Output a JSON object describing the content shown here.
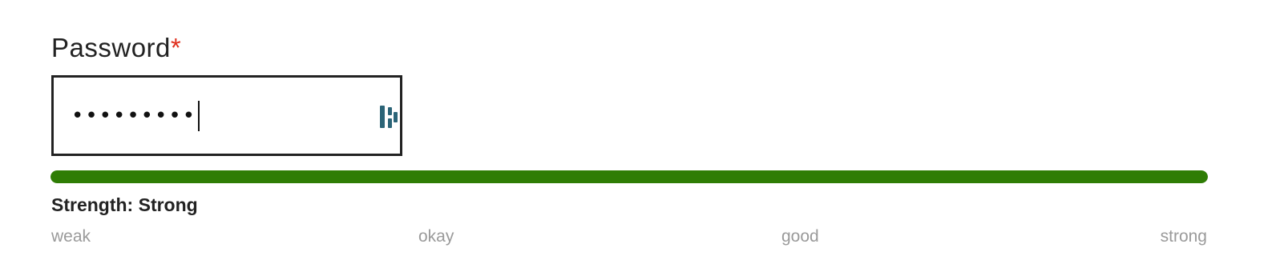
{
  "form": {
    "password": {
      "label": "Password",
      "required_mark": "*",
      "masked_value": "•••••••••",
      "manager_icon": "password-manager-icon"
    },
    "strength": {
      "text": "Strength: Strong",
      "level": "strong",
      "fill_fraction": 1.0,
      "fill_color": "#2f7d05",
      "scale": [
        "weak",
        "okay",
        "good",
        "strong"
      ]
    }
  },
  "colors": {
    "required": "#e0301e",
    "border": "#222222",
    "scale_text": "#9a9a9a",
    "icon": "#2b6477"
  }
}
